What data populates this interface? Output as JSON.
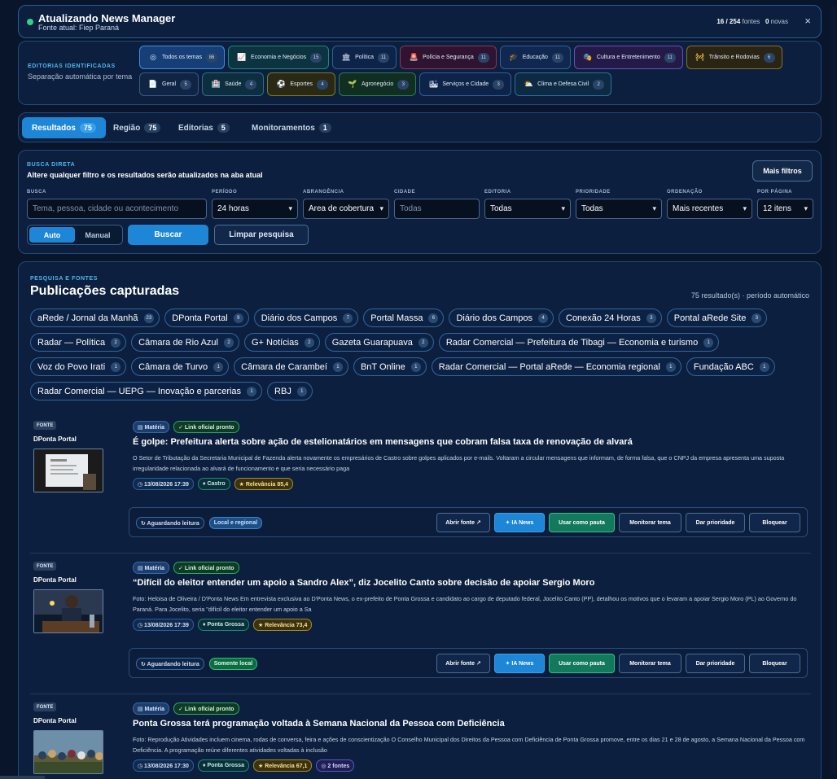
{
  "update": {
    "title": "Atualizando News Manager",
    "subtitle": "Fonte atual: Fiep Paraná",
    "fontes_count": "16 / 254",
    "fontes_label": " fontes",
    "novas_count": "0",
    "novas_label": " novas",
    "close": "×"
  },
  "editorias": {
    "title": "EDITORIAS IDENTIFICADAS",
    "subtitle": "Separação automática por tema",
    "chips": [
      {
        "label": "Todos os temas",
        "count": "86",
        "icon": "◎",
        "color": "#163f78",
        "border": "#3d8ee0"
      },
      {
        "label": "Economia e Negócios",
        "count": "15",
        "icon": "📈",
        "color": "#0c3340",
        "border": "#1f8a74"
      },
      {
        "label": "Política",
        "count": "11",
        "icon": "🏛",
        "color": "#0d2448",
        "border": "#2f5e9c"
      },
      {
        "label": "Polícia e Segurança",
        "count": "11",
        "icon": "🚨",
        "color": "#2e1430",
        "border": "#8a3660"
      },
      {
        "label": "Educação",
        "count": "11",
        "icon": "🎓",
        "color": "#102850",
        "border": "#2f5e9c"
      },
      {
        "label": "Cultura e Entretenimento",
        "count": "11",
        "icon": "🎭",
        "color": "#241a48",
        "border": "#6a4fb5"
      },
      {
        "label": "Trânsito e Rodovias",
        "count": "6",
        "icon": "🚧",
        "color": "#2a2414",
        "border": "#8a6f2b"
      },
      {
        "label": "Geral",
        "count": "5",
        "icon": "📄",
        "color": "#102444",
        "border": "#3c5880"
      },
      {
        "label": "Saúde",
        "count": "4",
        "icon": "🏥",
        "color": "#0d2e3e",
        "border": "#2f6e8c"
      },
      {
        "label": "Esportes",
        "count": "4",
        "icon": "⚽",
        "color": "#2a2a14",
        "border": "#7a7a2b"
      },
      {
        "label": "Agronegócio",
        "count": "3",
        "icon": "🌱",
        "color": "#102e22",
        "border": "#2f7a4e"
      },
      {
        "label": "Serviços e Cidade",
        "count": "3",
        "icon": "🏙",
        "color": "#0d2448",
        "border": "#2f5e9c"
      },
      {
        "label": "Clima e Defesa Civil",
        "count": "2",
        "icon": "⛅",
        "color": "#0d2a44",
        "border": "#2f6e9c"
      }
    ]
  },
  "tabs": [
    {
      "label": "Resultados",
      "count": "75"
    },
    {
      "label": "Região",
      "count": "75"
    },
    {
      "label": "Editorias",
      "count": "5"
    },
    {
      "label": "Monitoramentos",
      "count": "1"
    }
  ],
  "busca": {
    "title": "BUSCA DIRETA",
    "subtitle": "Altere qualquer filtro e os resultados serão atualizados na aba atual",
    "mais_filtros": "Mais filtros",
    "labels": {
      "busca": "BUSCA",
      "periodo": "PERÍODO",
      "abrangencia": "ABRANGÊNCIA",
      "cidade": "CIDADE",
      "editoria": "EDITORIA",
      "prioridade": "PRIORIDADE",
      "ordenacao": "ORDENAÇÃO",
      "por_pagina": "POR PÁGINA"
    },
    "busca_placeholder": "Tema, pessoa, cidade ou acontecimento",
    "periodo_value": "24 horas",
    "abrangencia_value": "Área de cobertura",
    "cidade_placeholder": "Todas",
    "editoria_value": "Todas",
    "prioridade_value": "Todas",
    "ordenacao_value": "Mais recentes",
    "por_pagina_value": "12 itens",
    "auto": "Auto",
    "manual": "Manual",
    "buscar": "Buscar",
    "limpar": "Limpar pesquisa"
  },
  "pub": {
    "kicker": "PESQUISA E FONTES",
    "title": "Publicações capturadas",
    "count": "75 resultado(s) · período automático",
    "sources": [
      {
        "name": "aRede / Jornal da Manhã",
        "count": "23"
      },
      {
        "name": "DPonta Portal",
        "count": "9"
      },
      {
        "name": "Diário dos Campos",
        "count": "7"
      },
      {
        "name": "Portal Massa",
        "count": "6"
      },
      {
        "name": "Diário dos Campos",
        "count": "4"
      },
      {
        "name": "Conexão 24 Horas",
        "count": "3"
      },
      {
        "name": "Pontal aRede Site",
        "count": "3"
      },
      {
        "name": "Radar — Política",
        "count": "2"
      },
      {
        "name": "Câmara de Rio Azul",
        "count": "2"
      },
      {
        "name": "G+ Notícias",
        "count": "2"
      },
      {
        "name": "Gazeta Guarapuava",
        "count": "2"
      },
      {
        "name": "Radar Comercial — Prefeitura de Tibagi — Economia e turismo",
        "count": "1"
      },
      {
        "name": "Voz do Povo Irati",
        "count": "1"
      },
      {
        "name": "Câmara de Turvo",
        "count": "1"
      },
      {
        "name": "Câmara de Carambeí",
        "count": "1"
      },
      {
        "name": "BnT Online",
        "count": "1"
      },
      {
        "name": "Radar Comercial — Portal aRede — Economia regional",
        "count": "1"
      },
      {
        "name": "Fundação ABC",
        "count": "1"
      },
      {
        "name": "Radar Comercial — UEPG — Inovação e parcerias",
        "count": "1"
      },
      {
        "name": "RBJ",
        "count": "1"
      }
    ]
  },
  "article_labels": {
    "fonte": "FONTE",
    "materia": "▤ Matéria",
    "link": "✓ Link oficial pronto",
    "aguardando": "↻ Aguardando leitura",
    "abrir_fonte": "Abrir fonte ↗",
    "ia_news": "✦ IA News",
    "usar_pauta": "Usar como pauta",
    "monitorar": "Monitorar tema",
    "dar_prioridade": "Dar prioridade",
    "bloquear": "Bloquear"
  },
  "articles": [
    {
      "fonte": "DPonta Portal",
      "title": "É golpe: Prefeitura alerta sobre ação de estelionatários em mensagens que cobram falsa taxa de renovação de alvará",
      "desc": "O Setor de Tributação da Secretaria Municipal de Fazenda alerta novamente os empresários de Castro sobre golpes aplicados por e-mails. Voltaram a circular mensagens que informam, de forma falsa, que o CNPJ da empresa apresenta uma suposta irregularidade relacionada ao alvará de funcionamento e que seria necessário paga",
      "date": "◷ 13/08/2026 17:39",
      "city": "♦ Castro",
      "relevancia": "★ Relevância 85,4",
      "status_tag": "Local e regional",
      "status_kind": "reg"
    },
    {
      "fonte": "DPonta Portal",
      "title": "“Difícil do eleitor entender um apoio a Sandro Alex”, diz Jocelito Canto sobre decisão de apoiar Sergio Moro",
      "desc": "Foto: Heloisa de Oliveira / D'Ponta News Em entrevista exclusiva ao D'Ponta News, o ex-prefeito de Ponta Grossa e candidato ao cargo de deputado federal, Jocelito Canto (PP), detalhou os motivos que o levaram a apoiar Sergio Moro (PL) ao Governo do Paraná. Para Jocelito, seria \"difícil do eleitor entender um apoio a Sa",
      "date": "◷ 13/08/2026 17:39",
      "city": "♦ Ponta Grossa",
      "relevancia": "★ Relevância 73,4",
      "status_tag": "Somente local",
      "status_kind": "local"
    },
    {
      "fonte": "DPonta Portal",
      "title": "Ponta Grossa terá programação voltada à Semana Nacional da Pessoa com Deficiência",
      "desc": "Foto: Reprodução Atividades incluem cinema, rodas de conversa, feira e ações de conscientização O Conselho Municipal dos Direitos da Pessoa com Deficiência de Ponta Grossa promove, entre os dias 21 e 28 de agosto, a Semana Nacional da Pessoa com Deficiência. A programação reúne diferentes atividades voltadas à inclusão",
      "date": "◷ 13/08/2026 17:30",
      "city": "♦ Ponta Grossa",
      "relevancia": "★ Relevância 67,1",
      "fontes": "◎ 2 fontes"
    }
  ]
}
